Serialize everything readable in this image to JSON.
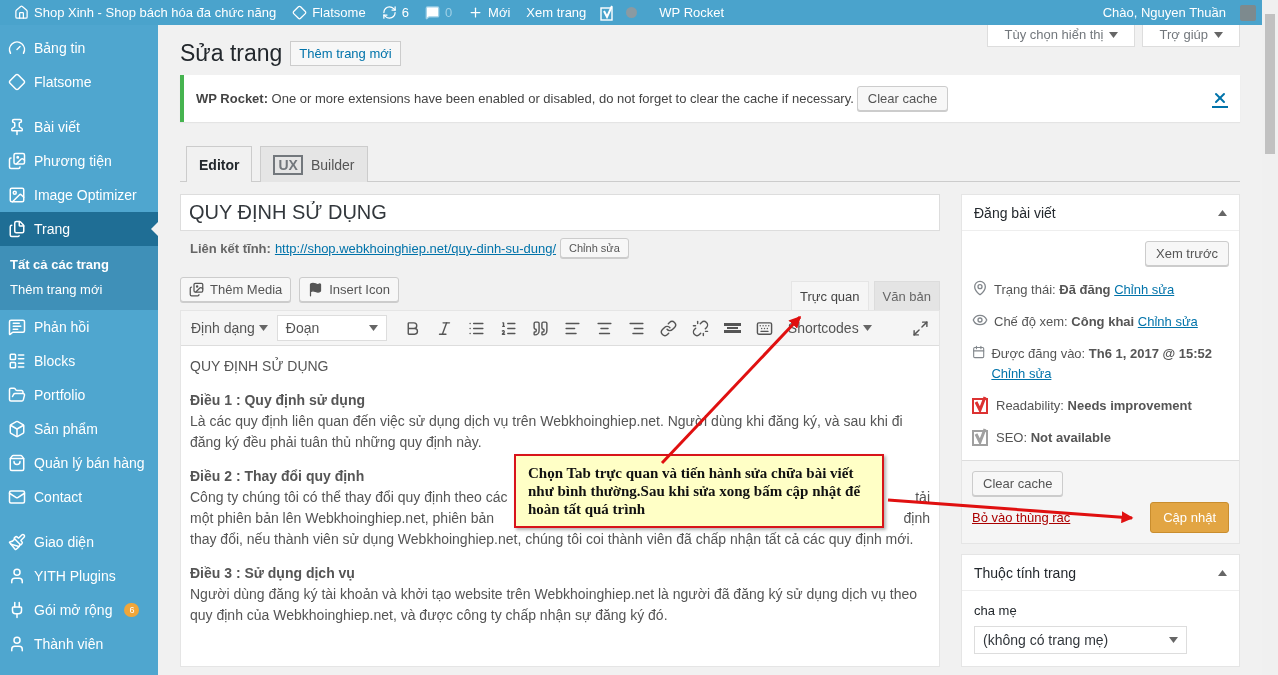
{
  "admin_bar": {
    "items": [
      {
        "kind": "site",
        "label": "Shop Xinh - Shop bách hóa đa chức năng"
      },
      {
        "kind": "theme",
        "label": "Flatsome"
      },
      {
        "kind": "updates",
        "label": "6"
      },
      {
        "kind": "comments",
        "label": "0"
      },
      {
        "kind": "new",
        "label": "Mới"
      },
      {
        "kind": "view",
        "label": "Xem trang"
      },
      {
        "kind": "seo"
      },
      {
        "kind": "status"
      },
      {
        "kind": "text",
        "label": "WP Rocket"
      }
    ],
    "greeting": "Chào, Nguyen Thuần"
  },
  "sidebar": {
    "groups": [
      [
        {
          "label": "Bảng tin",
          "selected": false
        },
        {
          "label": "Flatsome",
          "selected": false
        }
      ],
      [
        {
          "label": "Bài viết",
          "selected": false
        },
        {
          "label": "Phương tiện",
          "selected": false
        },
        {
          "label": "Image Optimizer",
          "selected": false
        },
        {
          "label": "Trang",
          "selected": true,
          "children": [
            {
              "label": "Tất cả các trang",
              "selected": true
            },
            {
              "label": "Thêm trang mới",
              "selected": false
            }
          ]
        },
        {
          "label": "Phản hồi",
          "selected": false
        },
        {
          "label": "Blocks",
          "selected": false
        },
        {
          "label": "Portfolio",
          "selected": false
        },
        {
          "label": "Sản phẩm",
          "selected": false
        },
        {
          "label": "Quản lý bán hàng",
          "selected": false
        },
        {
          "label": "Contact",
          "selected": false
        }
      ],
      [
        {
          "label": "Giao diện",
          "selected": false
        },
        {
          "label": "YITH Plugins",
          "selected": false
        },
        {
          "label": "Gói mở rộng",
          "selected": false,
          "badge": "6"
        },
        {
          "label": "Thành viên",
          "selected": false
        }
      ]
    ]
  },
  "screen_tabs": [
    "Tùy chọn hiển thị",
    "Trợ giúp"
  ],
  "page_title": "Sửa trang",
  "add_new": "Thêm trang mới",
  "notice": {
    "text": "**WP Rocket:** One or more extensions have been enabled or disabled, do not forget to clear the cache if necessary.",
    "button": "Clear cache"
  },
  "editor_tabs": [
    {
      "label": "Editor",
      "selected": true
    },
    {
      "badge": "UX",
      "label": "Builder",
      "selected": false
    }
  ],
  "post_title": "QUY ĐỊNH SỬ DỤNG",
  "permalink": {
    "label": "Liên kết tĩnh:",
    "url": "http://shop.webkhoinghiep.net/quy-dinh-su-dung/",
    "button": "Chỉnh sửa"
  },
  "media_buttons": [
    {
      "kind": "media",
      "label": "Thêm Media"
    },
    {
      "kind": "icon",
      "label": "Insert Icon"
    }
  ],
  "mode_tabs": [
    {
      "label": "Trực quan",
      "selected": true
    },
    {
      "label": "Văn bản",
      "selected": false
    }
  ],
  "toolbar": {
    "format": "Định dạng",
    "block": "Đoạn",
    "shortcodes": "Shortcodes"
  },
  "content": {
    "heading": "QUY ĐỊNH SỬ DỤNG",
    "sections": [
      {
        "kind": "text",
        "title": "Điều 1 : Quy định sử dụng",
        "text": "Là các quy định liên quan đến việc sử dụng dịch vụ trên Webkhoinghiep.net. Người dùng khi đăng ký, và sau khi đi đăng ký đều phải tuân thủ những quy định này."
      },
      {
        "kind": "covered",
        "title": "Điều 2 : Thay đổi quy định",
        "covered_lines": [
          {
            "left": "Công ty chúng tôi có thể thay đổi quy định theo các",
            "right": "tải"
          },
          {
            "left": "một phiên bản lên Webkhoinghiep.net, phiên bản",
            "right": "định"
          }
        ],
        "text": "thay đổi, nếu thành viên sử dụng Webkhoinghiep.net, chúng tôi coi thành viên đã chấp nhận tất cả các quy định mới."
      },
      {
        "kind": "text",
        "title": "Điều 3 : Sử dụng dịch vụ",
        "text": "Người dùng đăng ký tài khoản và khởi tạo website trên Webkhoinghiep.net là người đã đăng ký sử dụng dịch vụ theo quy định của Webkhoinghiep.net, và được công ty chấp nhận sự đăng ký đó."
      }
    ]
  },
  "callout": "Chọn Tab trực quan và tiến hành sửa chữa bài viết như bình thường.Sau khi sửa xong bấm cập nhật để hoàn tất quá trình",
  "publish": {
    "title": "Đăng bài viết",
    "preview": "Xem trước",
    "rows": [
      {
        "kind": "status",
        "text": "Trạng thái: **Đã đăng**",
        "link": "Chỉnh sửa"
      },
      {
        "kind": "visibility",
        "text": "Chế độ xem: **Công khai**",
        "link": "Chỉnh sửa"
      },
      {
        "kind": "date",
        "text": "Được đăng vào: **Th6 1, 2017 @ 15:52**",
        "link": "Chỉnh sửa"
      },
      {
        "kind": "yoast",
        "text": "Readability: **Needs improvement**",
        "color": "#dc3232"
      },
      {
        "kind": "yoast",
        "text": "SEO: **Not available**",
        "color": "#a0a0a0"
      }
    ],
    "clear_cache": "Clear cache",
    "trash": "Bỏ vào thùng rác",
    "update": "Cập nhật"
  },
  "attributes": {
    "title": "Thuộc tính trang",
    "parent_label": "cha mẹ",
    "parent_value": "(không có trang mẹ)"
  }
}
